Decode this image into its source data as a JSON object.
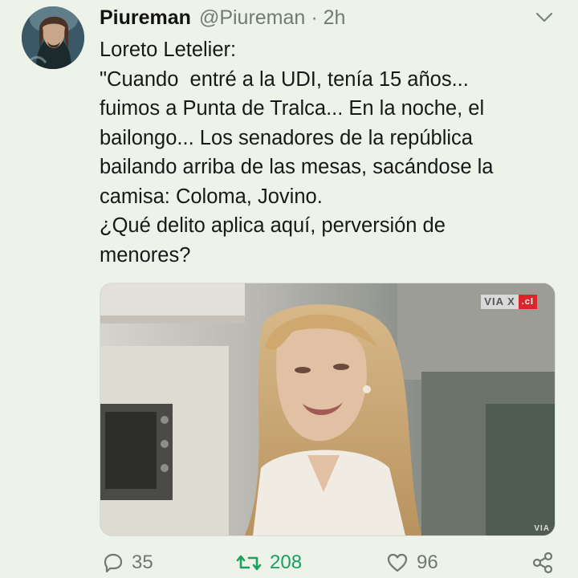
{
  "tweet": {
    "author": {
      "display_name": "Piureman",
      "handle": "@Piureman",
      "separator": "·",
      "time": "2h"
    },
    "text_lines": [
      "Loreto Letelier:",
      "\"Cuando  entré a la UDI, tenía 15 años...",
      "fuimos a Punta de Tralca... En la noche, el",
      "bailongo... Los senadores de la república",
      "bailando arriba de las mesas, sacándose la",
      "camisa: Coloma, Jovino.",
      "¿Qué delito aplica aquí, perversión de",
      "menores?"
    ],
    "media": {
      "watermark_text": "VIA X",
      "watermark_domain": ".cl",
      "corner_watermark": "VIA"
    },
    "actions": {
      "reply_count": "35",
      "retweet_count": "208",
      "like_count": "96"
    }
  },
  "icons": {
    "more": "chevron-down-icon",
    "reply": "reply-icon",
    "retweet": "retweet-icon",
    "like": "heart-icon",
    "share": "share-icon"
  },
  "colors": {
    "background": "#eef3ea",
    "retweet_active": "#17a05e",
    "muted_text": "#707b76",
    "watermark_red": "#d8262b"
  }
}
